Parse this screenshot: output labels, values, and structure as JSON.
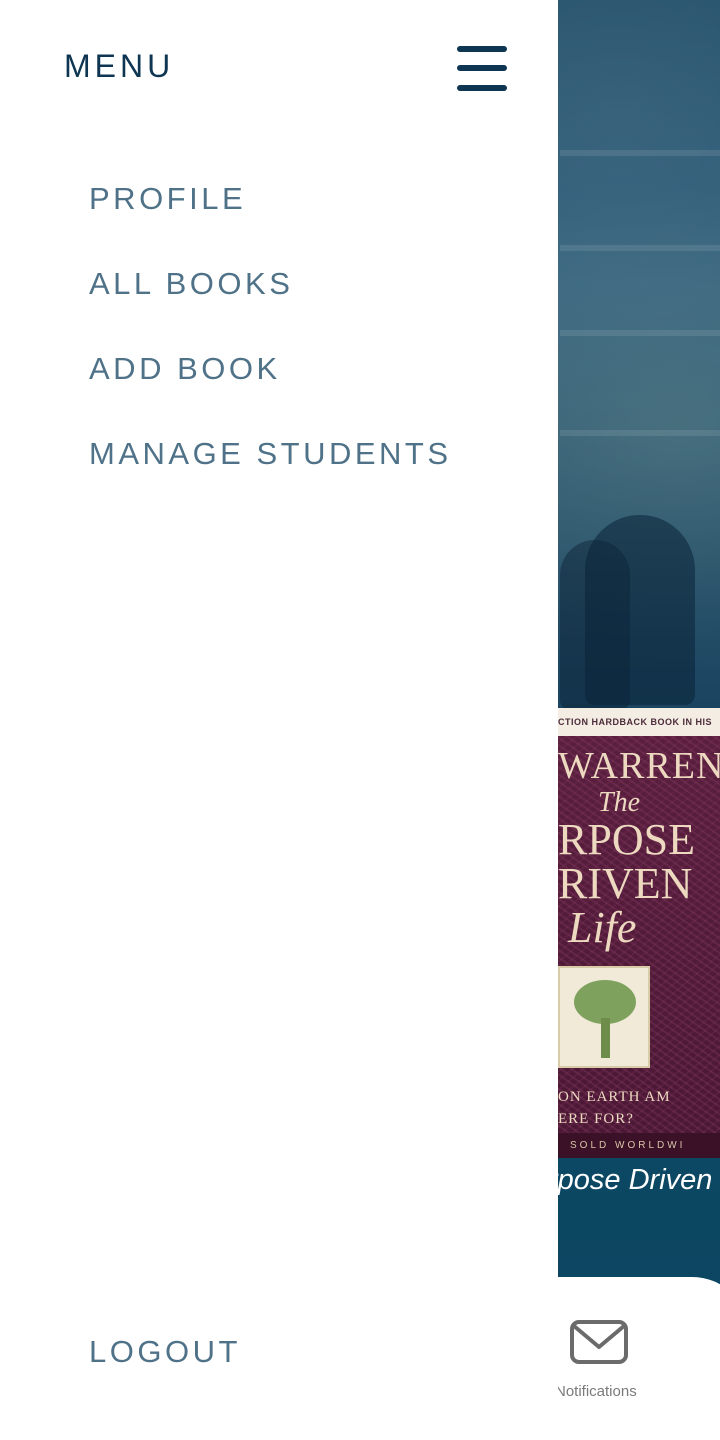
{
  "drawer": {
    "title": "MENU",
    "toggle_icon": "hamburger-icon",
    "items": [
      {
        "label": "PROFILE"
      },
      {
        "label": "ALL BOOKS"
      },
      {
        "label": "ADD BOOK"
      },
      {
        "label": "MANAGE STUDENTS"
      }
    ],
    "logout_label": "LOGOUT"
  },
  "background_app": {
    "book": {
      "cover_banner": "CTION HARDBACK BOOK IN HIS",
      "cover_author": "WARREN",
      "cover_title_line1": "The",
      "cover_title_line2": "RPOSE",
      "cover_title_line3": "RIVEN",
      "cover_title_line4": "Life",
      "cover_quote_line1": "ON EARTH AM",
      "cover_quote_line2": "ERE FOR?",
      "cover_band": "SOLD WORLDWI",
      "caption": "rpose Driven"
    },
    "bottom_nav": {
      "notifications_icon": "mail-icon",
      "notifications_label": "Notifications"
    }
  },
  "colors": {
    "drawer_bg": "#ffffff",
    "title": "#0e3552",
    "nav_text": "#4f7288",
    "app_bg": "#0e3a55",
    "cover": "#5a1e3d"
  }
}
